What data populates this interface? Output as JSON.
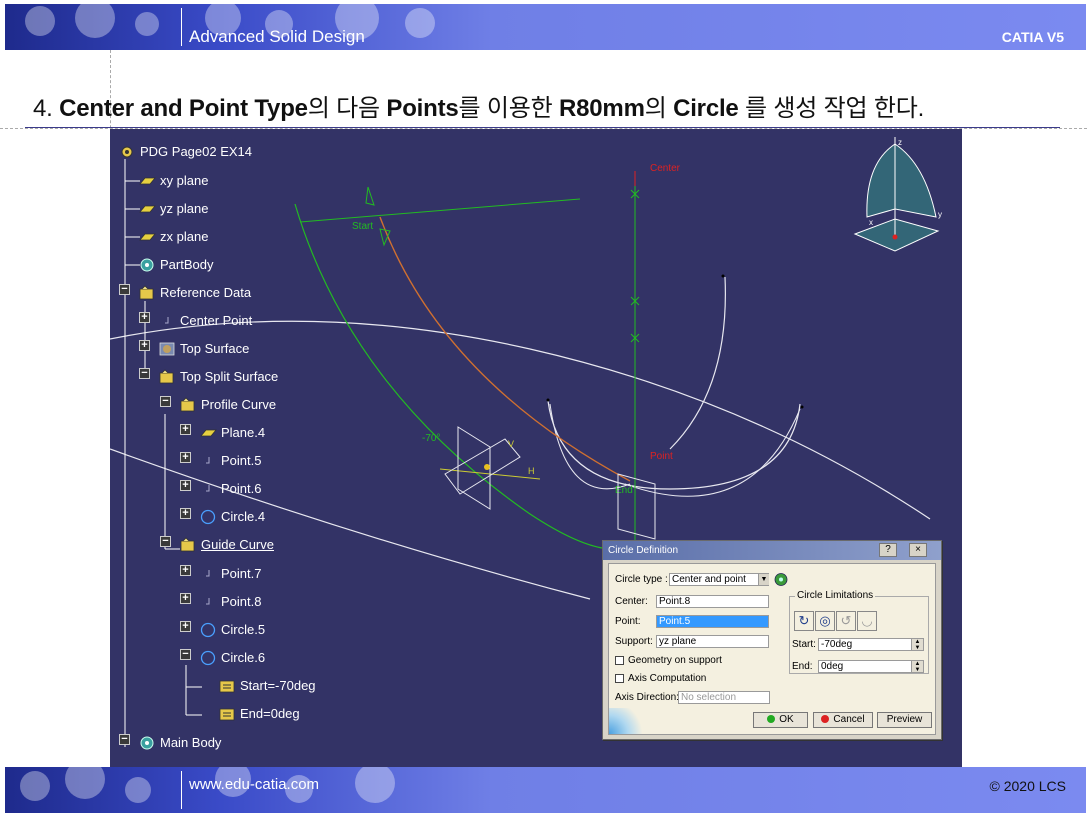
{
  "header": {
    "course": "Advanced Solid Design",
    "brand": "CATIA V5"
  },
  "footer": {
    "site": "www.edu-catia.com",
    "copyright": "© 2020 LCS"
  },
  "heading": {
    "p1": "4. ",
    "b1": "Center and Point Type",
    "p2": "의 다음 ",
    "b2": "Points",
    "p3": "를 이용한 ",
    "b3": "R80mm",
    "p4": "의 ",
    "b4": "Circle",
    "p5": " 를 생성 작업 한다."
  },
  "tree": {
    "items": [
      {
        "label": "PDG Page02 EX14",
        "icon": "part-gear-icon"
      },
      {
        "label": "xy plane",
        "icon": "plane-icon"
      },
      {
        "label": "yz plane",
        "icon": "plane-icon"
      },
      {
        "label": "zx plane",
        "icon": "plane-icon"
      },
      {
        "label": "PartBody",
        "icon": "body-gear-icon"
      },
      {
        "label": "Reference Data",
        "icon": "geometrical-set-icon"
      },
      {
        "label": "Center Point",
        "icon": "point-icon"
      },
      {
        "label": "Top Surface",
        "icon": "surface-icon"
      },
      {
        "label": "Top Split Surface",
        "icon": "geometrical-set-icon"
      },
      {
        "label": "Profile Curve",
        "icon": "geometrical-set-icon"
      },
      {
        "label": "Plane.4",
        "icon": "plane-icon"
      },
      {
        "label": "Point.5",
        "icon": "point-icon"
      },
      {
        "label": "Point.6",
        "icon": "point-icon"
      },
      {
        "label": "Circle.4",
        "icon": "circle-icon"
      },
      {
        "label": "Guide Curve",
        "icon": "geometrical-set-icon"
      },
      {
        "label": "Point.7",
        "icon": "point-icon"
      },
      {
        "label": "Point.8",
        "icon": "point-icon"
      },
      {
        "label": "Circle.5",
        "icon": "circle-icon"
      },
      {
        "label": "Circle.6",
        "icon": "circle-icon"
      },
      {
        "label": "Start=-70deg",
        "icon": "parameter-icon"
      },
      {
        "label": "End=0deg",
        "icon": "parameter-icon"
      },
      {
        "label": "Main Body",
        "icon": "body-gear-icon"
      }
    ]
  },
  "viewport": {
    "labels": {
      "center": "Center",
      "start": "Start",
      "angle": "-70°",
      "point": "Point",
      "end": "End",
      "axis_h": "H",
      "axis_v": "V"
    },
    "compass": {
      "z": "z",
      "x": "x",
      "y": "y"
    }
  },
  "dialog": {
    "title": "Circle Definition",
    "help_label": "?",
    "close_label": "×",
    "circle_type_label": "Circle type :",
    "circle_type_value": "Center and point",
    "center_label": "Center:",
    "center_value": "Point.8",
    "point_label": "Point:",
    "point_value": "Point.5",
    "support_label": "Support:",
    "support_value": "yz plane",
    "geometry_on_support": "Geometry on support",
    "axis_computation": "Axis Computation",
    "axis_direction_label": "Axis Direction:",
    "axis_direction_placeholder": "No selection",
    "limitations_title": "Circle Limitations",
    "start_label": "Start:",
    "start_value": "-70deg",
    "end_label": "End:",
    "end_value": "0deg",
    "ok_label": "OK",
    "cancel_label": "Cancel",
    "preview_label": "Preview"
  },
  "colors": {
    "viewport_bg": "#333366",
    "selected_field": "#3399ff",
    "axis_green": "#22bb22",
    "arc_orange": "#d07030"
  }
}
